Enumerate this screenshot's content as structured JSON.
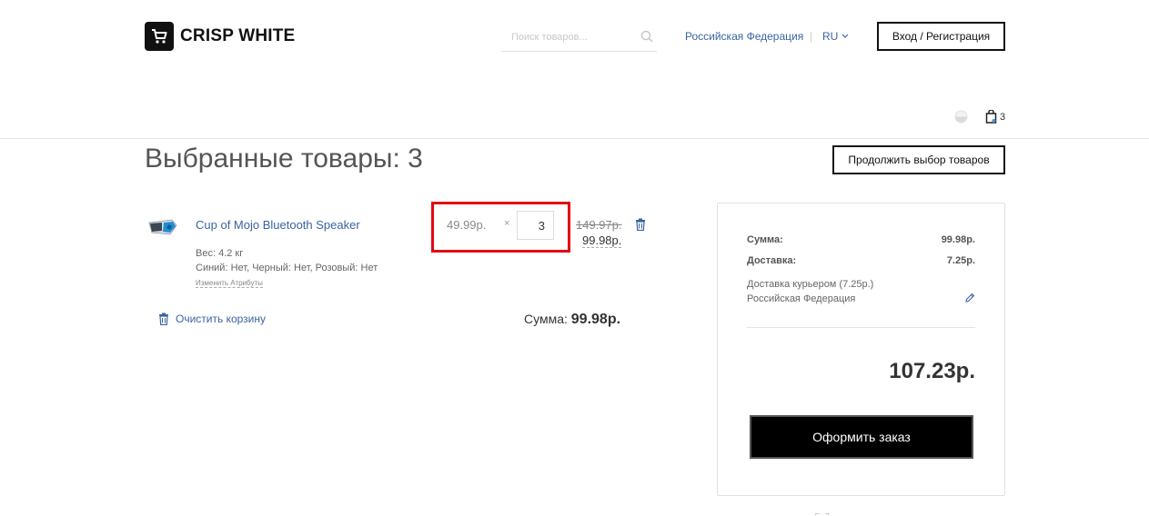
{
  "header": {
    "logo_text": "CRISP WHITE",
    "search_placeholder": "Поиск товаров...",
    "region": "Российская Федерация",
    "separator": "|",
    "language": "RU",
    "login_label": "Вход / Регистрация",
    "cart_count": "3"
  },
  "page": {
    "title": "Выбранные товары: 3",
    "continue_label": "Продолжить выбор товаров"
  },
  "cart": {
    "items": [
      {
        "name": "Cup of Mojo Bluetooth Speaker",
        "weight": "Вес: 4.2 кг",
        "attributes": "Синий: Нет, Черный: Нет, Розовый: Нет",
        "change_attributes": "Изменить Атрибуты",
        "unit_price": "49.99р.",
        "times": "×",
        "quantity": "3",
        "old_price": "149.97р.",
        "new_price": "99.98р."
      }
    ],
    "clear_label": "Очистить корзину",
    "subtotal_label": "Сумма:",
    "subtotal_value": "99.98р."
  },
  "summary": {
    "sum_label": "Сумма:",
    "sum_value": "99.98р.",
    "delivery_label": "Доставка:",
    "delivery_value": "7.25р.",
    "delivery_method": "Доставка курьером (7.25р.)",
    "delivery_region": "Российская Федерация",
    "total": "107.23р.",
    "checkout_label": "Оформить заказ"
  },
  "colors": {
    "link": "#3a64a0",
    "highlight": "#e30613",
    "button_dark": "#000000"
  },
  "icons": [
    "cart-logo-icon",
    "search-icon",
    "chevron-down-icon",
    "compare-icon",
    "shopping-bag-icon",
    "trash-icon",
    "pencil-icon"
  ]
}
